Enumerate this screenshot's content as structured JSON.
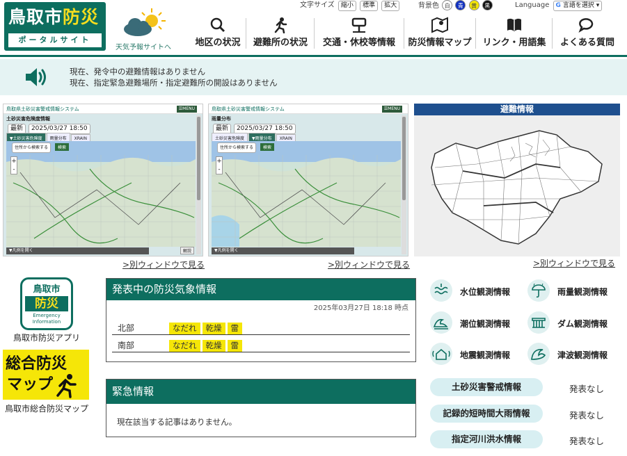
{
  "header": {
    "logo": {
      "main_a": "鳥取市",
      "main_b": "防災",
      "sub": "ポータルサイト"
    },
    "weather_link": "天気予報サイトへ",
    "text_size": {
      "label": "文字サイズ",
      "small": "縮小",
      "standard": "標準",
      "large": "拡大"
    },
    "bg_color": {
      "label": "背景色",
      "white": "白",
      "blue": "青",
      "yellow": "黄",
      "black": "黒"
    },
    "language": {
      "label": "Language",
      "select": "言語を選択"
    },
    "nav": [
      {
        "label": "地区の状況",
        "icon": "magnifier-icon"
      },
      {
        "label": "避難所の状況",
        "icon": "running-person-icon"
      },
      {
        "label": "交通・休校等情報",
        "icon": "bus-stop-icon"
      },
      {
        "label": "防災情報マップ",
        "icon": "map-pin-icon"
      },
      {
        "label": "リンク・用語集",
        "icon": "book-icon"
      },
      {
        "label": "よくある質問",
        "icon": "speech-bubble-icon"
      }
    ]
  },
  "notice": {
    "line1": "現在、発令中の避難情報はありません",
    "line2": "現在、指定緊急避難場所・指定避難所の開設はありません"
  },
  "maps": [
    {
      "system": "鳥取県土砂災害警戒情報システム",
      "menu": "☰MENU",
      "title": "土砂災害危険度情報",
      "latest": "最新",
      "date": "2025/03/27 18:50",
      "tabs": [
        "▼土砂災害危険度",
        "雨量分布",
        "XRAIN"
      ],
      "search": "住所から検索する",
      "search_btn": "検索",
      "footer": "▼凡例を開く",
      "help": "解説",
      "link": ">別ウィンドウで見る"
    },
    {
      "system": "鳥取県土砂災害警戒情報システム",
      "menu": "☰MENU",
      "title": "雨量分布",
      "latest": "最新",
      "date": "2025/03/27 18:50",
      "tabs": [
        "土砂災害危険度",
        "▼雨量分布",
        "XRAIN"
      ],
      "search": "住所から検索する",
      "search_btn": "検索",
      "footer": "▼凡例を開く",
      "help": "",
      "link": ">別ウィンドウで見る"
    }
  ],
  "evacuation": {
    "title": "避難情報",
    "link": ">別ウィンドウで見る"
  },
  "apps": [
    {
      "label": "鳥取市防災アプリ"
    },
    {
      "label": "鳥取市総合防災マップ"
    }
  ],
  "app_icon": {
    "l1": "鳥取市",
    "l2": "防災",
    "l3": "Emergency",
    "l4": "Information"
  },
  "map_badge": {
    "l1": "総合防災",
    "l2": "マップ"
  },
  "weather_info": {
    "title": "発表中の防災気象情報",
    "timestamp": "2025年03月27日 18:18 時点",
    "rows": [
      {
        "region": "北部",
        "tags": [
          "なだれ",
          "乾燥",
          "雷"
        ]
      },
      {
        "region": "南部",
        "tags": [
          "なだれ",
          "乾燥",
          "雷"
        ]
      }
    ]
  },
  "emergency": {
    "title": "緊急情報",
    "text": "現在該当する記事はありません。"
  },
  "observations": [
    {
      "label": "水位観測情報",
      "icon": "water-level-icon"
    },
    {
      "label": "雨量観測情報",
      "icon": "rain-umbrella-icon"
    },
    {
      "label": "潮位観測情報",
      "icon": "tide-wave-icon"
    },
    {
      "label": "ダム観測情報",
      "icon": "dam-icon"
    },
    {
      "label": "地震観測情報",
      "icon": "earthquake-house-icon"
    },
    {
      "label": "津波観測情報",
      "icon": "tsunami-wave-icon"
    }
  ],
  "warnings": [
    {
      "label": "土砂災害警戒情報",
      "status": "発表なし"
    },
    {
      "label": "記録的短時間大雨情報",
      "status": "発表なし"
    },
    {
      "label": "指定河川洪水情報",
      "status": "発表なし"
    }
  ]
}
